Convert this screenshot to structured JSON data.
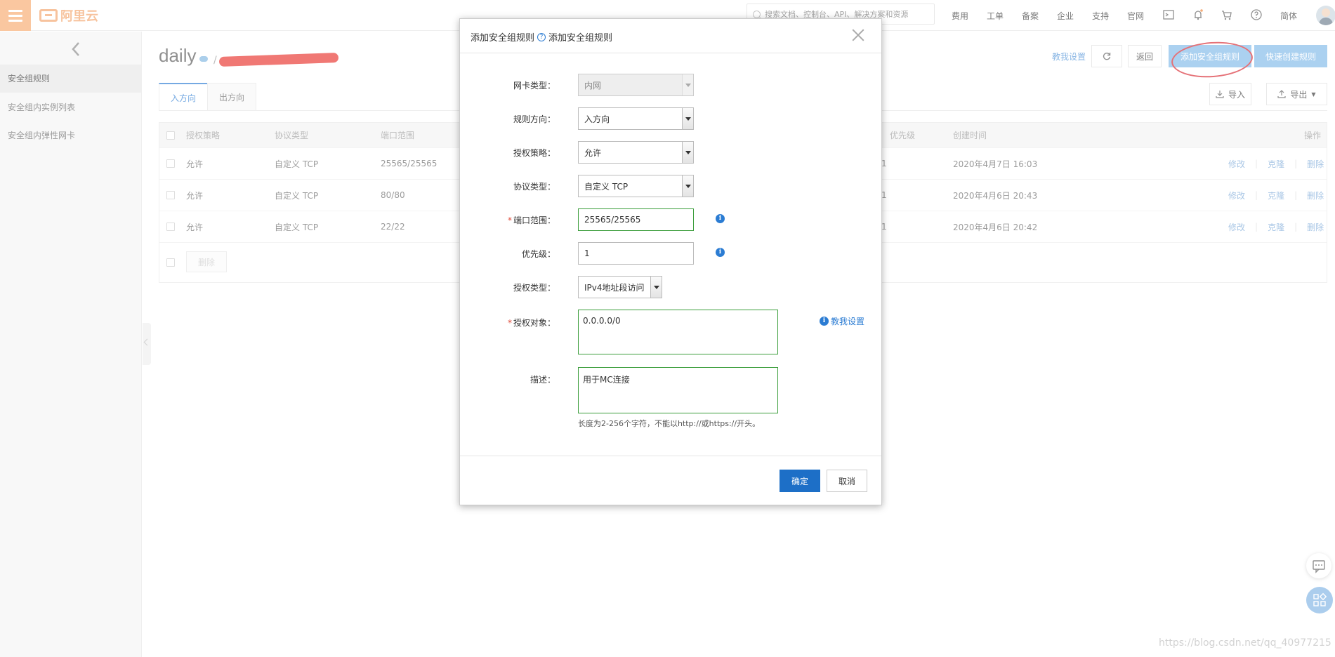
{
  "header": {
    "logo_text": "阿里云",
    "search_placeholder": "搜索文档、控制台、API、解决方案和资源",
    "nav": [
      "费用",
      "工单",
      "备案",
      "企业",
      "支持",
      "官网"
    ],
    "lang": "简体",
    "icons": [
      "terminal-icon",
      "bell-icon",
      "cart-icon",
      "help-icon"
    ]
  },
  "sidebar": {
    "items": [
      "安全组规则",
      "安全组内实例列表",
      "安全组内弹性网卡"
    ]
  },
  "page": {
    "title": "daily",
    "teach_link": "教我设置",
    "back_btn": "返回",
    "add_rule_btn": "添加安全组规则",
    "quick_rule_btn": "快速创建规则",
    "import_btn": "导入",
    "export_btn": "导出"
  },
  "tabs": [
    "入方向",
    "出方向"
  ],
  "table": {
    "columns": [
      "授权策略",
      "协议类型",
      "端口范围",
      "优先级",
      "创建时间",
      "操作"
    ],
    "rows": [
      {
        "policy": "允许",
        "protocol": "自定义 TCP",
        "port": "25565/25565",
        "priority": "1",
        "time": "2020年4月7日 16:03"
      },
      {
        "policy": "允许",
        "protocol": "自定义 TCP",
        "port": "80/80",
        "priority": "1",
        "time": "2020年4月6日 20:43"
      },
      {
        "policy": "允许",
        "protocol": "自定义 TCP",
        "port": "22/22",
        "priority": "1",
        "time": "2020年4月6日 20:42"
      }
    ],
    "ops": [
      "修改",
      "克隆",
      "删除"
    ],
    "delete_btn": "删除"
  },
  "modal": {
    "title": "添加安全组规则",
    "title_help": "添加安全组规则",
    "labels": {
      "nic": "网卡类型：",
      "direction": "规则方向：",
      "policy": "授权策略：",
      "protocol": "协议类型：",
      "port": "端口范围：",
      "priority": "优先级：",
      "auth_type": "授权类型：",
      "auth_obj": "授权对象：",
      "desc": "描述："
    },
    "values": {
      "nic": "内网",
      "direction": "入方向",
      "policy": "允许",
      "protocol": "自定义 TCP",
      "port": "25565/25565",
      "priority": "1",
      "auth_type": "IPv4地址段访问",
      "auth_obj": "0.0.0.0/0",
      "desc": "用于MC连接"
    },
    "teach_link": "教我设置",
    "desc_hint": "长度为2-256个字符，不能以http://或https://开头。",
    "ok": "确定",
    "cancel": "取消"
  },
  "watermark": "https://blog.csdn.net/qq_40977215"
}
